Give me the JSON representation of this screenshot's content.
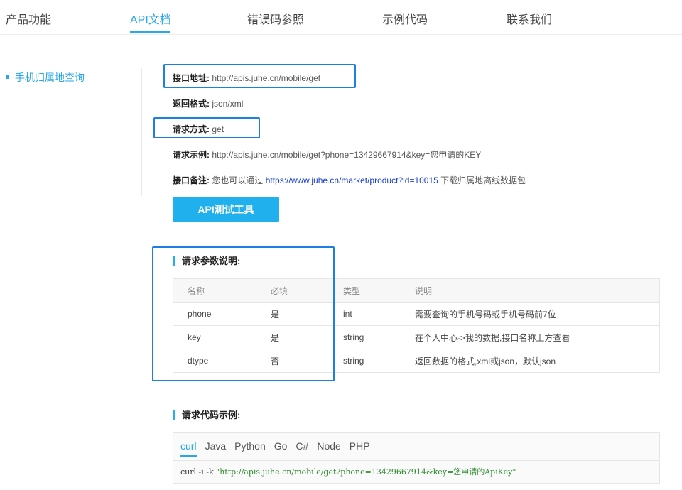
{
  "nav": {
    "tabs": [
      {
        "label": "产品功能"
      },
      {
        "label": "API文档",
        "active": true
      },
      {
        "label": "错误码参照"
      },
      {
        "label": "示例代码"
      },
      {
        "label": "联系我们"
      }
    ]
  },
  "sidebar": {
    "items": [
      {
        "label": "手机归属地查询"
      }
    ]
  },
  "api": {
    "address_label": "接口地址:",
    "address_value": "http://apis.juhe.cn/mobile/get",
    "format_label": "返回格式:",
    "format_value": "json/xml",
    "method_label": "请求方式:",
    "method_value": "get",
    "example_label": "请求示例:",
    "example_value": "http://apis.juhe.cn/mobile/get?phone=13429667914&key=您申请的KEY",
    "note_label": "接口备注:",
    "note_prefix": "您也可以通过 ",
    "note_link": "https://www.juhe.cn/market/product?id=10015",
    "note_suffix": " 下载归属地离线数据包",
    "test_button": "API测试工具"
  },
  "params": {
    "title": "请求参数说明:",
    "headers": [
      "名称",
      "必填",
      "类型",
      "说明"
    ],
    "rows": [
      {
        "name": "phone",
        "required": "是",
        "type": "int",
        "desc": "需要查询的手机号码或手机号码前7位"
      },
      {
        "name": "key",
        "required": "是",
        "type": "string",
        "desc": "在个人中心->我的数据,接口名称上方查看"
      },
      {
        "name": "dtype",
        "required": "否",
        "type": "string",
        "desc": "返回数据的格式,xml或json，默认json"
      }
    ]
  },
  "code": {
    "title": "请求代码示例:",
    "tabs": [
      "curl",
      "Java",
      "Python",
      "Go",
      "C#",
      "Node",
      "PHP"
    ],
    "active_tab": "curl",
    "line_cmd": "curl -i -k ",
    "line_str": "\"http://apis.juhe.cn/mobile/get?phone=13429667914&key=您申请的ApiKey\""
  },
  "colors": {
    "accent": "#2aa7e8",
    "button": "#21b0ee",
    "highlight_box": "#1e7fe3",
    "link": "#1a3fcf"
  }
}
